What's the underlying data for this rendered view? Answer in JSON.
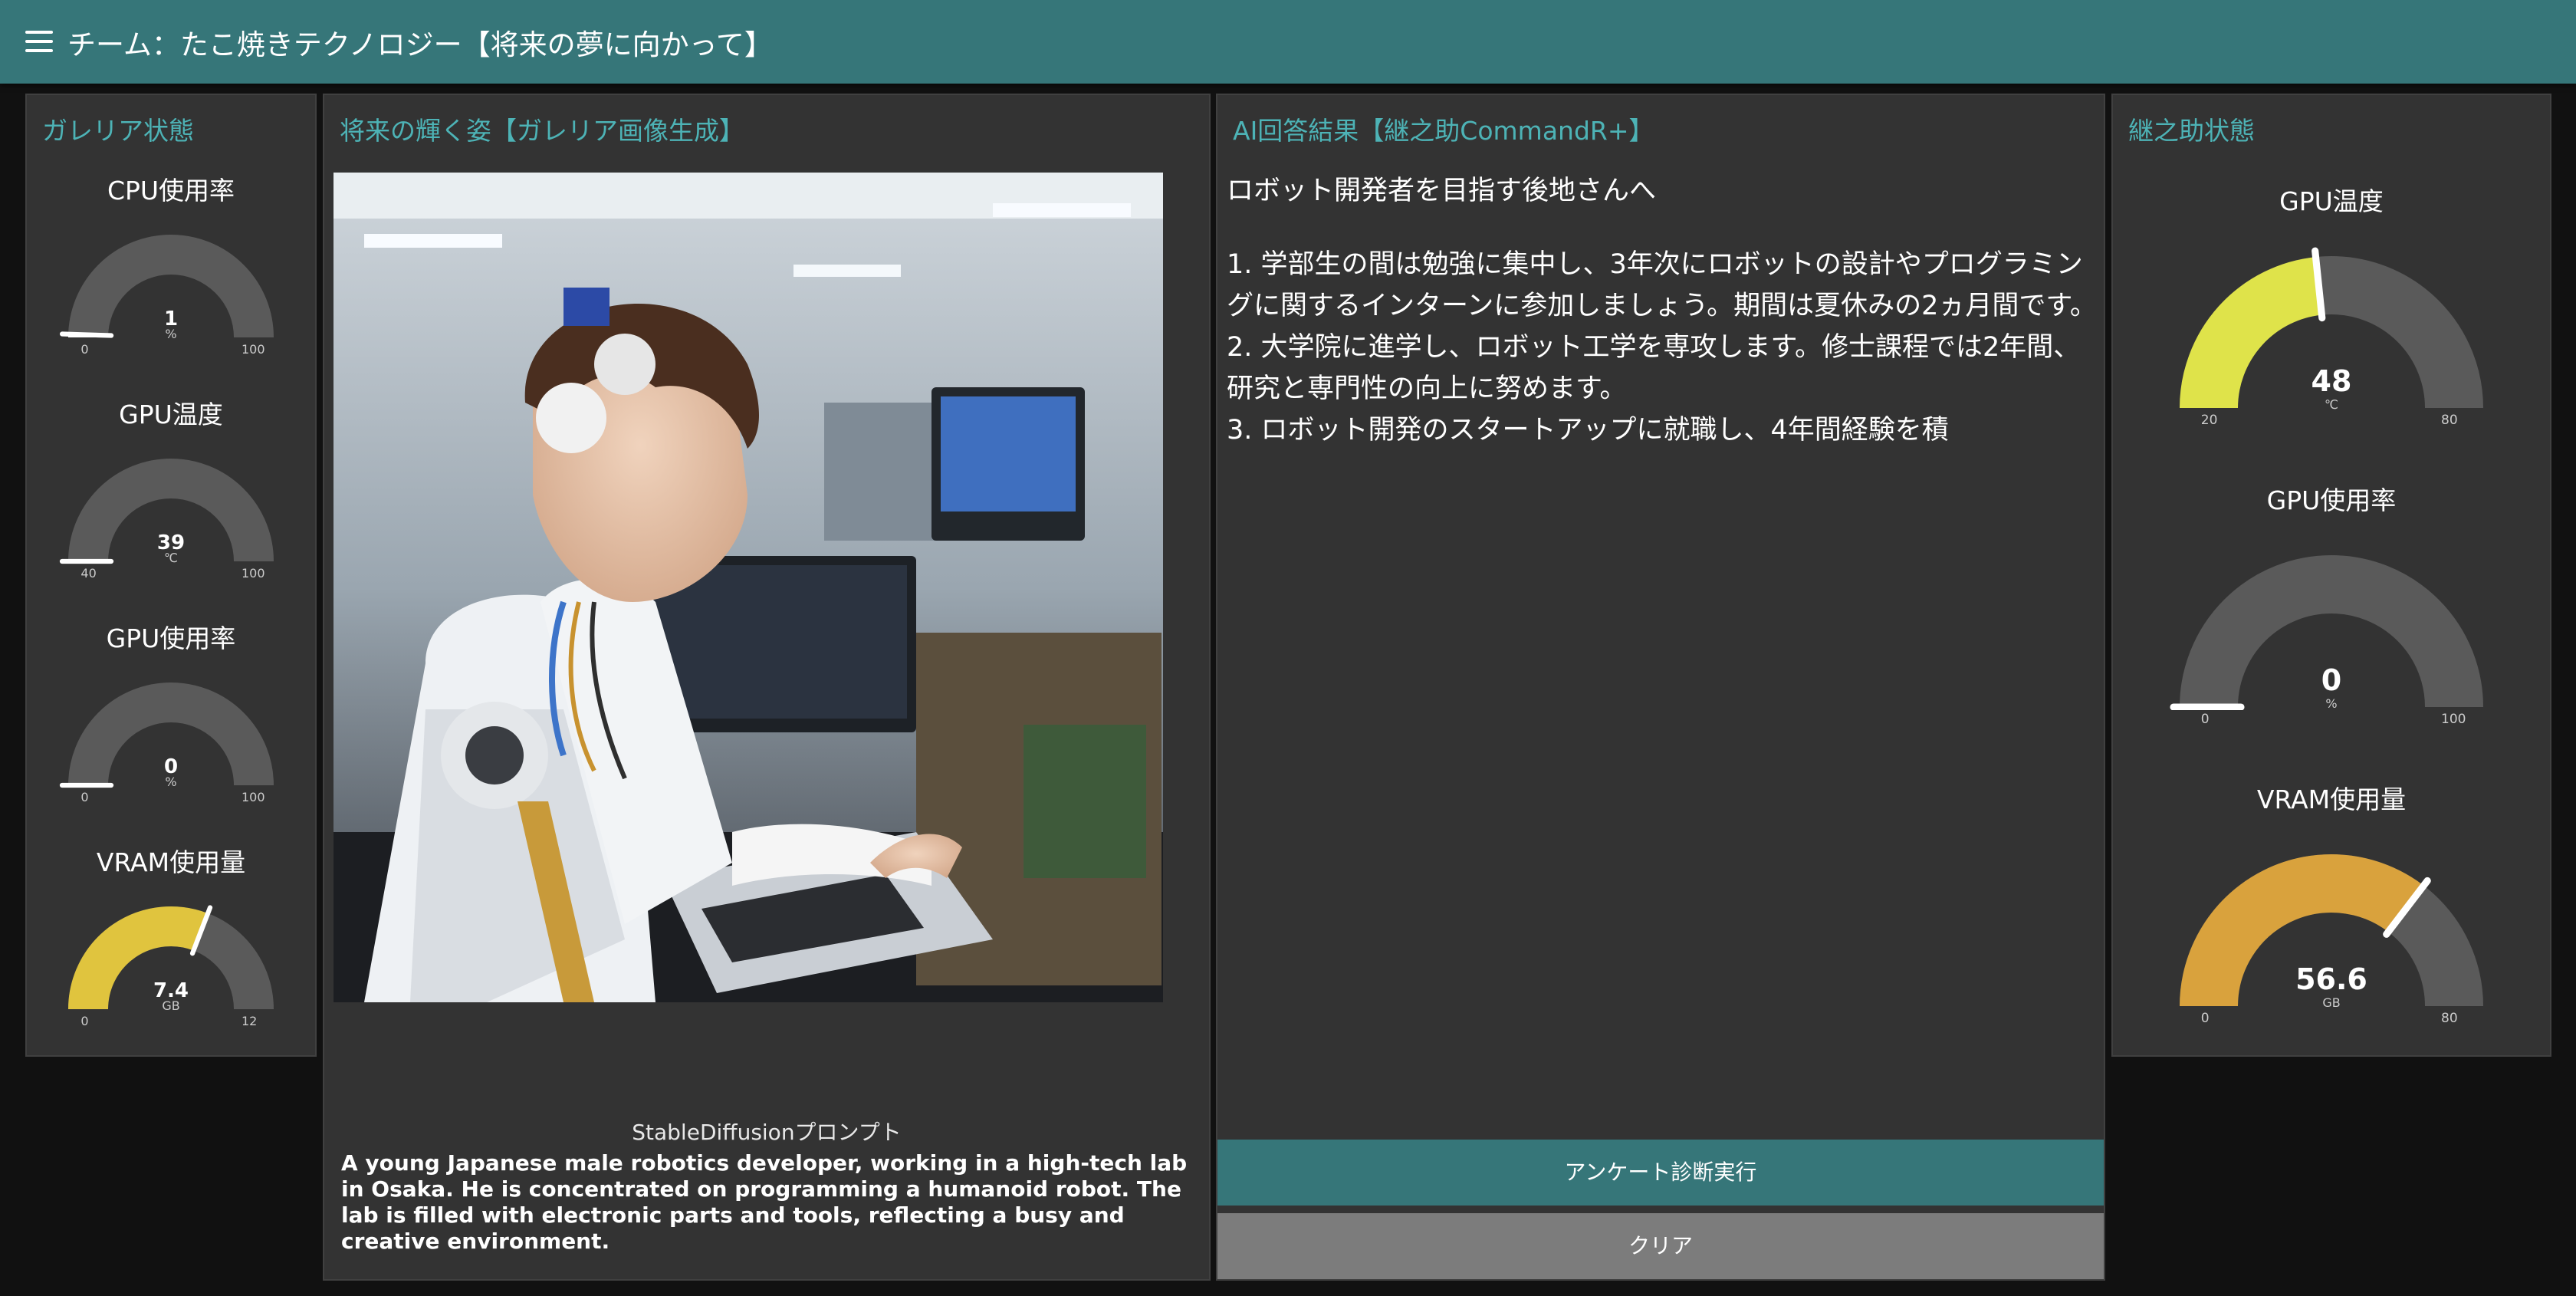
{
  "header": {
    "menu_icon": "menu-icon",
    "title": "チーム：たこ焼きテクノロジー【将来の夢に向かって】"
  },
  "galleria_panel": {
    "title": "ガレリア状態",
    "gauges": [
      {
        "label": "CPU使用率",
        "value": "1",
        "unit": "%",
        "min": "0",
        "max": "100",
        "fraction": 0.01,
        "color": "#ffffff"
      },
      {
        "label": "GPU温度",
        "value": "39",
        "unit": "℃",
        "min": "40",
        "max": "100",
        "fraction": 0.0,
        "color": "#ffffff"
      },
      {
        "label": "GPU使用率",
        "value": "0",
        "unit": "%",
        "min": "0",
        "max": "100",
        "fraction": 0.0,
        "color": "#ffffff"
      },
      {
        "label": "VRAM使用量",
        "value": "7.4",
        "unit": "GB",
        "min": "0",
        "max": "12",
        "fraction": 0.617,
        "color": "#e0c43e"
      }
    ]
  },
  "image_panel": {
    "title": "将来の輝く姿【ガレリア画像生成】",
    "prompt_label": "StableDiffusionプロンプト",
    "prompt_text": "A young Japanese male robotics developer, working in a high-tech lab in Osaka. He is concentrated on programming a humanoid robot. The lab is filled with electronic parts and tools, reflecting a busy and creative environment."
  },
  "answer_panel": {
    "title": "AI回答結果【継之助CommandR+】",
    "greeting": "ロボット開発者を目指す後地さんへ",
    "lines": [
      "1. 学部生の間は勉強に集中し、3年次にロボットの設計やプログラミングに関するインターンに参加しましょう。期間は夏休みの2ヵ月間です。",
      "2. 大学院に進学し、ロボット工学を専攻します。修士課程では2年間、研究と専門性の向上に努めます。",
      "3. ロボット開発のスタートアップに就職し、4年間経験を積"
    ],
    "run_button": "アンケート診断実行",
    "clear_button": "クリア"
  },
  "tsugunosuke_panel": {
    "title": "継之助状態",
    "gauges": [
      {
        "label": "GPU温度",
        "value": "48",
        "unit": "℃",
        "min": "20",
        "max": "80",
        "fraction": 0.467,
        "color": "#dfe34a"
      },
      {
        "label": "GPU使用率",
        "value": "0",
        "unit": "%",
        "min": "0",
        "max": "100",
        "fraction": 0.0,
        "color": "#ffffff"
      },
      {
        "label": "VRAM使用量",
        "value": "56.6",
        "unit": "GB",
        "min": "0",
        "max": "80",
        "fraction": 0.708,
        "color": "#d9a23d"
      }
    ]
  },
  "colors": {
    "accent": "#367679",
    "panel_title": "#4db3b6",
    "gauge_track": "#5a5a5a"
  }
}
